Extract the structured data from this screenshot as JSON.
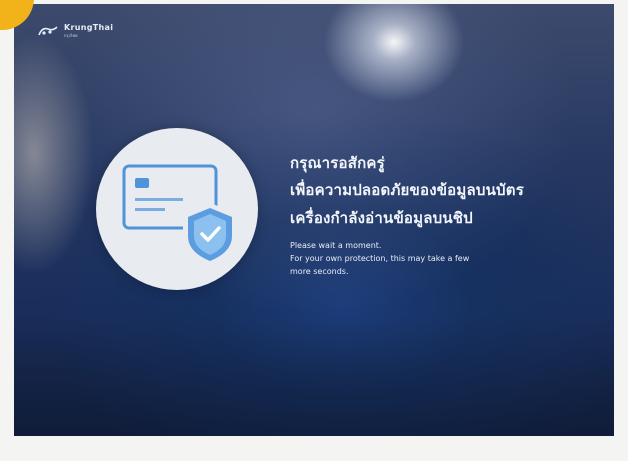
{
  "brand": {
    "name": "KrungThai",
    "subtitle": "กรุงไทย"
  },
  "message": {
    "thai_lines": [
      "กรุณารอสักครู่",
      "เพื่อความปลอดภัยของข้อมูลบนบัตร",
      "เครื่องกำลังอ่านข้อมูลบนชิป"
    ],
    "english_lines": [
      "Please wait a moment.",
      "For your own protection, this may take a few",
      "more seconds."
    ]
  },
  "illustration": {
    "icons": [
      "card-icon",
      "shield-check-icon"
    ]
  },
  "colors": {
    "accent_tag": "#f2b21a",
    "screen_blue": "#1c3c7a",
    "icon_blue": "#4f94d8"
  }
}
